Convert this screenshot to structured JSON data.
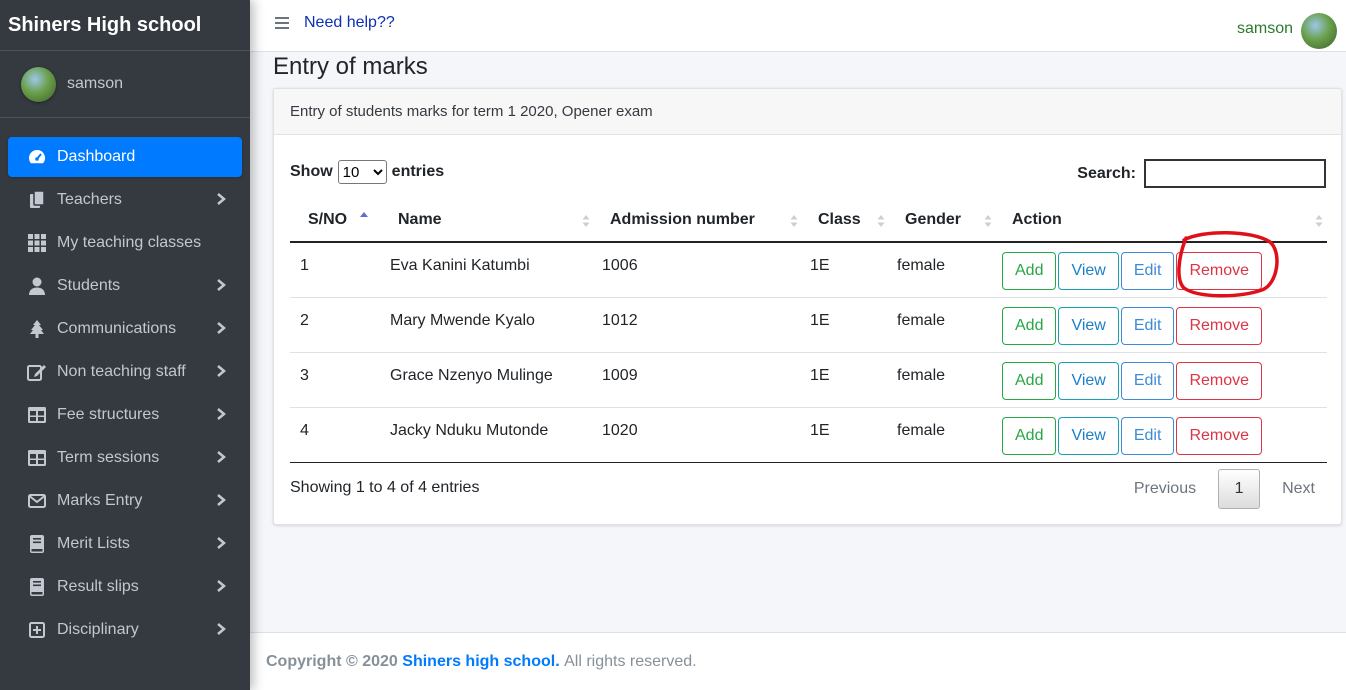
{
  "brand": "Shiners High school",
  "sidebar": {
    "user": "samson",
    "items": [
      {
        "label": "Dashboard",
        "icon": "dashboard-gauge-icon",
        "active": true,
        "chevron": false
      },
      {
        "label": "Teachers",
        "icon": "copy-icon",
        "chevron": true
      },
      {
        "label": "My teaching classes",
        "icon": "grid-icon",
        "chevron": false
      },
      {
        "label": "Students",
        "icon": "user-icon",
        "chevron": true
      },
      {
        "label": "Communications",
        "icon": "tree-icon",
        "chevron": true
      },
      {
        "label": "Non teaching staff",
        "icon": "edit-icon",
        "chevron": true
      },
      {
        "label": "Fee structures",
        "icon": "table-icon",
        "chevron": true
      },
      {
        "label": "Term sessions",
        "icon": "table-icon",
        "chevron": true
      },
      {
        "label": "Marks Entry",
        "icon": "envelope-icon",
        "chevron": true
      },
      {
        "label": "Merit Lists",
        "icon": "book-icon",
        "chevron": true
      },
      {
        "label": "Result slips",
        "icon": "book-icon",
        "chevron": true
      },
      {
        "label": "Disciplinary",
        "icon": "plus-square-icon",
        "chevron": true
      }
    ]
  },
  "topbar": {
    "help": "Need help??",
    "user": "samson"
  },
  "page": {
    "title": "Entry of marks",
    "card_header": "Entry of students marks for term 1 2020, Opener exam"
  },
  "table": {
    "show_label": "Show",
    "entries_label": "entries",
    "page_length": "10",
    "search_label": "Search:",
    "search_value": "",
    "columns": [
      "S/NO",
      "Name",
      "Admission number",
      "Class",
      "Gender",
      "Action"
    ],
    "rows": [
      {
        "sno": "1",
        "name": "Eva Kanini Katumbi",
        "adm": "1006",
        "class": "1E",
        "gender": "female"
      },
      {
        "sno": "2",
        "name": "Mary Mwende Kyalo",
        "adm": "1012",
        "class": "1E",
        "gender": "female"
      },
      {
        "sno": "3",
        "name": "Grace Nzenyo Mulinge",
        "adm": "1009",
        "class": "1E",
        "gender": "female"
      },
      {
        "sno": "4",
        "name": "Jacky Nduku Mutonde",
        "adm": "1020",
        "class": "1E",
        "gender": "female"
      }
    ],
    "actions": {
      "add": "Add",
      "view": "View",
      "edit": "Edit",
      "remove": "Remove"
    },
    "info": "Showing 1 to 4 of 4 entries",
    "pagination": {
      "previous": "Previous",
      "current": "1",
      "next": "Next"
    }
  },
  "footer": {
    "copyright": "Copyright © 2020",
    "school": "Shiners high school.",
    "rights": "All rights reserved."
  },
  "colors": {
    "sidebar_bg": "#343a40",
    "active_bg": "#007bff",
    "annotation": "#e0101a"
  }
}
